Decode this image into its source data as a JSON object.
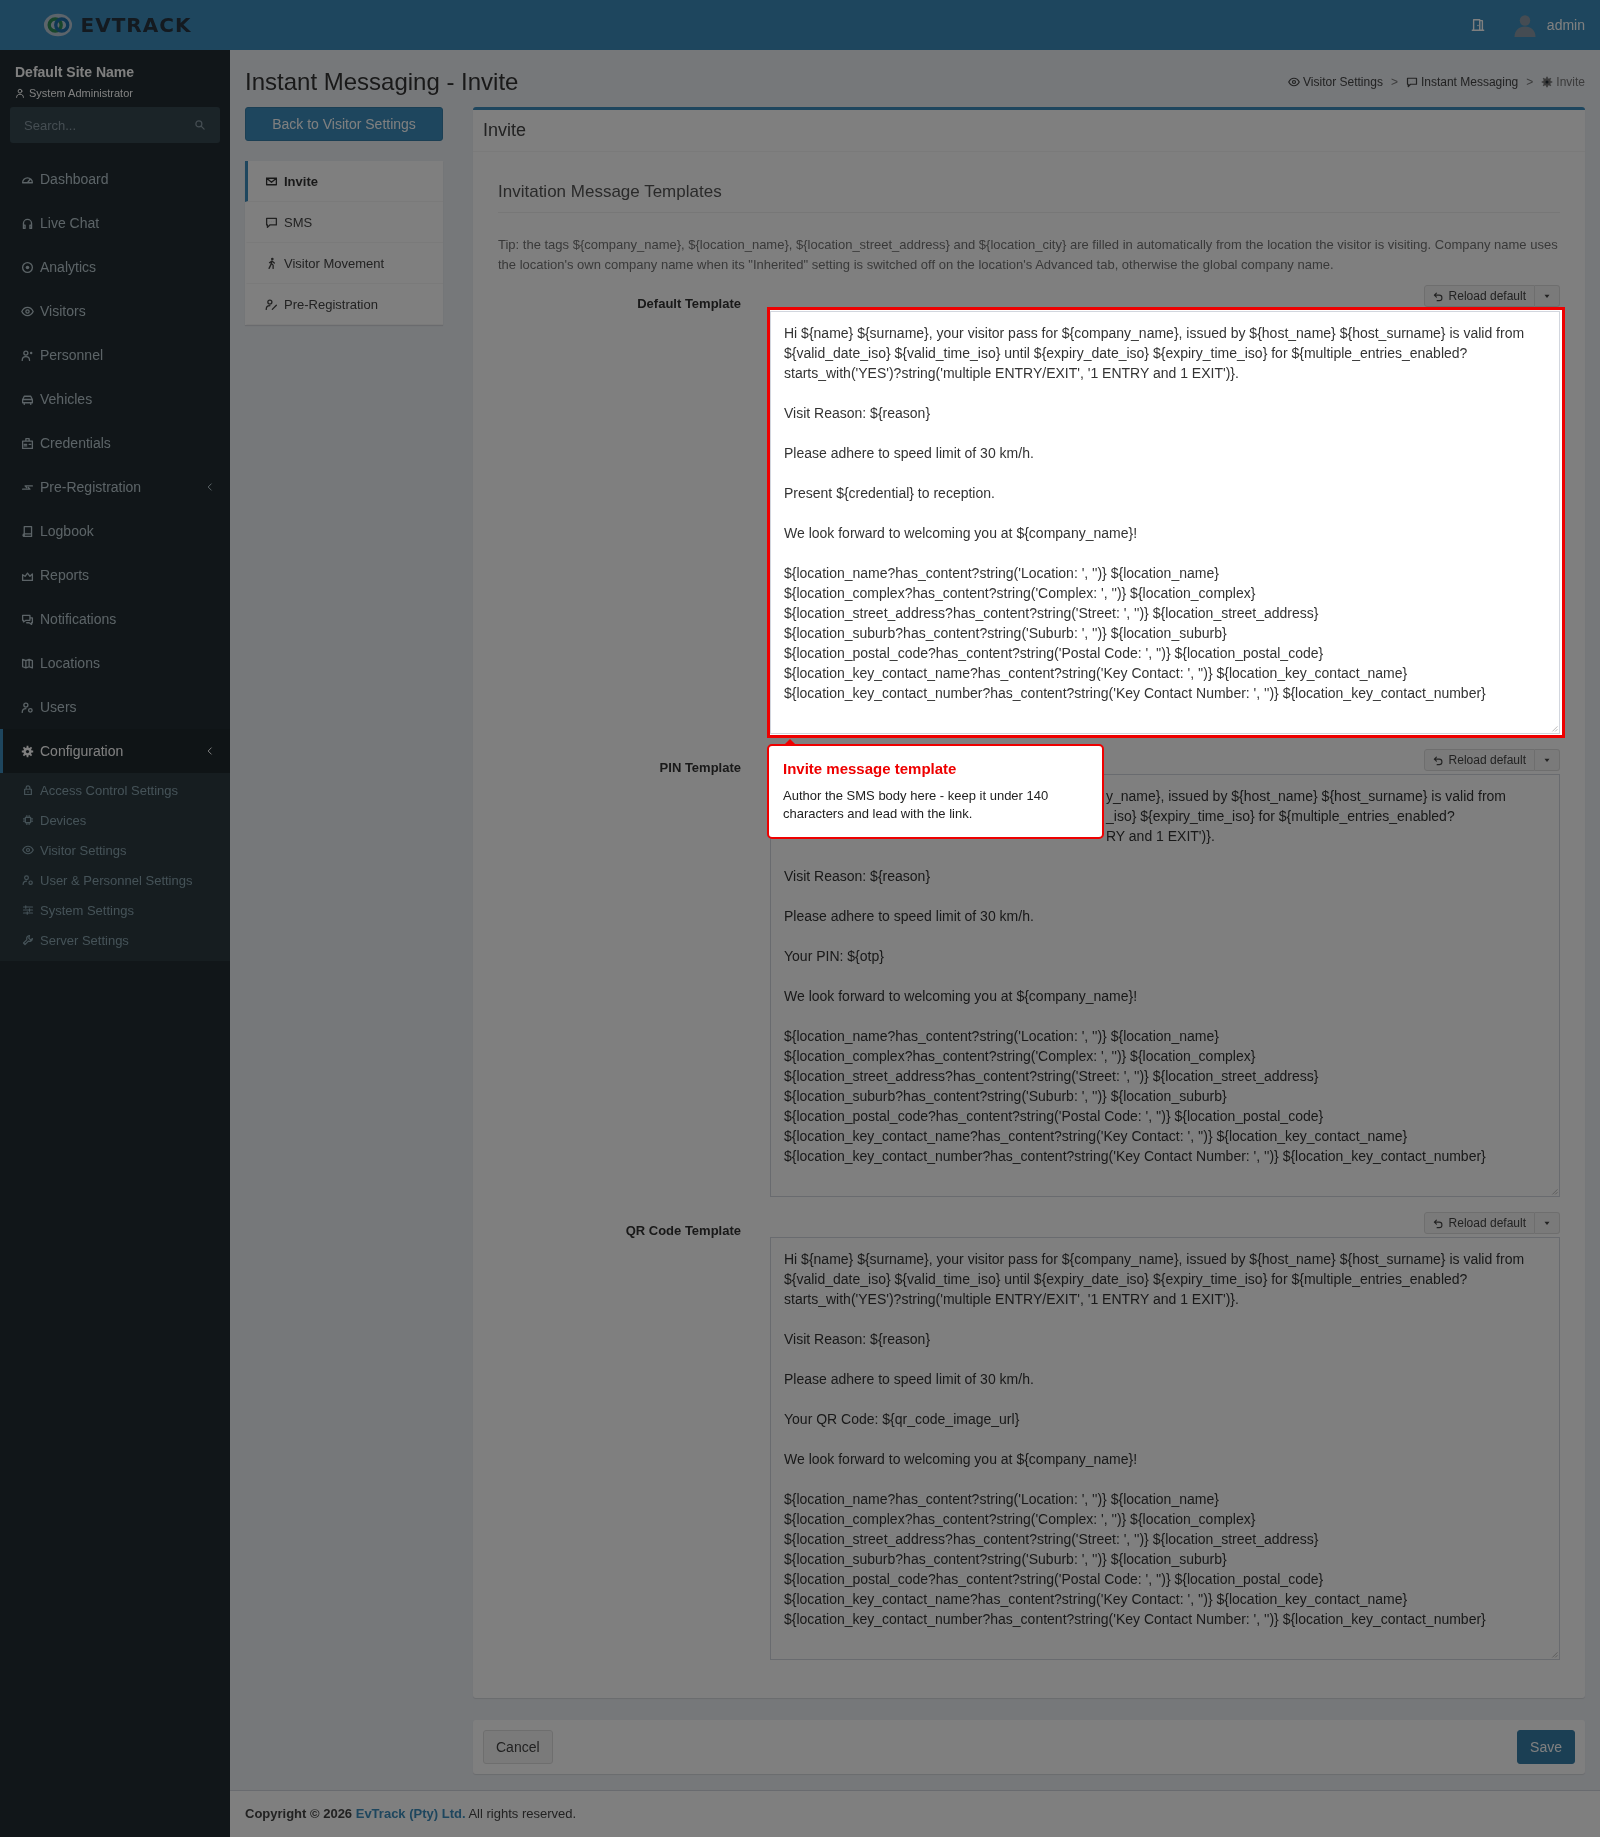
{
  "topbar": {
    "logo_text": "EVTRACK",
    "user": "admin"
  },
  "sidebar": {
    "site_name": "Default Site Name",
    "role": "System Administrator",
    "search": {
      "placeholder": "Search..."
    },
    "items": [
      {
        "label": "Dashboard",
        "selected": false
      },
      {
        "label": "Live Chat",
        "selected": false
      },
      {
        "label": "Analytics",
        "selected": false
      },
      {
        "label": "Visitors",
        "selected": false
      },
      {
        "label": "Personnel",
        "selected": false
      },
      {
        "label": "Vehicles",
        "selected": false
      },
      {
        "label": "Credentials",
        "selected": false
      },
      {
        "label": "Pre-Registration",
        "selected": false,
        "expandable": true
      },
      {
        "label": "Logbook",
        "selected": false
      },
      {
        "label": "Reports",
        "selected": false
      },
      {
        "label": "Notifications",
        "selected": false
      },
      {
        "label": "Locations",
        "selected": false
      },
      {
        "label": "Users",
        "selected": false
      },
      {
        "label": "Configuration",
        "selected": true,
        "expandable": true,
        "expanded": true,
        "children": [
          {
            "label": "Access Control Settings",
            "selected": false
          },
          {
            "label": "Devices",
            "selected": false
          },
          {
            "label": "Visitor Settings",
            "selected": false
          },
          {
            "label": "User & Personnel Settings",
            "selected": false
          },
          {
            "label": "System Settings",
            "selected": false
          },
          {
            "label": "Server Settings",
            "selected": false
          }
        ]
      }
    ]
  },
  "page": {
    "title": "Instant Messaging - Invite",
    "breadcrumb": [
      {
        "kind": "link",
        "label": "Visitor Settings"
      },
      {
        "kind": "separator",
        "label": ">"
      },
      {
        "kind": "link",
        "label": "Instant Messaging"
      },
      {
        "kind": "separator",
        "label": ">"
      },
      {
        "kind": "current",
        "label": "Invite"
      }
    ]
  },
  "back_button": "Back to Visitor Settings",
  "tabs": [
    {
      "label": "Invite",
      "selected": true
    },
    {
      "label": "SMS",
      "selected": false
    },
    {
      "label": "Visitor Movement",
      "selected": false
    },
    {
      "label": "Pre-Registration",
      "selected": false
    }
  ],
  "panel": {
    "title": "Invite",
    "section_title": "Invitation Message Templates",
    "tip": "Tip: the tags ${company_name}, ${location_name}, ${location_street_address} and ${location_city} are filled in automatically from the location the visitor is visiting. Company name uses the location's own company name when its \"Inherited\" setting is switched off on the location's Advanced tab, otherwise the global company name.",
    "templates": [
      {
        "label": "Default Template",
        "reload_label": "Reload default",
        "highlighted": true,
        "value": "Hi ${name} ${surname}, your visitor pass for ${company_name}, issued by ${host_name} ${host_surname} is valid from\n${valid_date_iso} ${valid_time_iso} until ${expiry_date_iso} ${expiry_time_iso} for ${multiple_entries_enabled?\nstarts_with('YES')?string('multiple ENTRY/EXIT', '1 ENTRY and 1 EXIT')}.\n\nVisit Reason: ${reason}\n\nPlease adhere to speed limit of 30 km/h.\n\nPresent ${credential} to reception.\n\nWe look forward to welcoming you at ${company_name}!\n\n${location_name?has_content?string('Location: ', '')} ${location_name}\n${location_complex?has_content?string('Complex: ', '')} ${location_complex}\n${location_street_address?has_content?string('Street: ', '')} ${location_street_address}\n${location_suburb?has_content?string('Suburb: ', '')} ${location_suburb}\n${location_postal_code?has_content?string('Postal Code: ', '')} ${location_postal_code}\n${location_key_contact_name?has_content?string('Key Contact: ', '')} ${location_key_contact_name}\n${location_key_contact_number?has_content?string('Key Contact Number: ', '')} ${location_key_contact_number}"
      },
      {
        "label": "PIN Template",
        "reload_label": "Reload default",
        "highlighted": false,
        "covered_lines": [
          "y_name}, issued by ${host_name} ${host_surname} is valid from",
          "_iso} ${expiry_time_iso} for ${multiple_entries_enabled?",
          "RY and 1 EXIT')}."
        ],
        "value": "\nVisit Reason: ${reason}\n\nPlease adhere to speed limit of 30 km/h.\n\nYour PIN: ${otp}\n\nWe look forward to welcoming you at ${company_name}!\n\n${location_name?has_content?string('Location: ', '')} ${location_name}\n${location_complex?has_content?string('Complex: ', '')} ${location_complex}\n${location_street_address?has_content?string('Street: ', '')} ${location_street_address}\n${location_suburb?has_content?string('Suburb: ', '')} ${location_suburb}\n${location_postal_code?has_content?string('Postal Code: ', '')} ${location_postal_code}\n${location_key_contact_name?has_content?string('Key Contact: ', '')} ${location_key_contact_name}\n${location_key_contact_number?has_content?string('Key Contact Number: ', '')} ${location_key_contact_number}"
      },
      {
        "label": "QR Code Template",
        "reload_label": "Reload default",
        "highlighted": false,
        "value": "Hi ${name} ${surname}, your visitor pass for ${company_name}, issued by ${host_name} ${host_surname} is valid from\n${valid_date_iso} ${valid_time_iso} until ${expiry_date_iso} ${expiry_time_iso} for ${multiple_entries_enabled?\nstarts_with('YES')?string('multiple ENTRY/EXIT', '1 ENTRY and 1 EXIT')}.\n\nVisit Reason: ${reason}\n\nPlease adhere to speed limit of 30 km/h.\n\nYour QR Code: ${qr_code_image_url}\n\nWe look forward to welcoming you at ${company_name}!\n\n${location_name?has_content?string('Location: ', '')} ${location_name}\n${location_complex?has_content?string('Complex: ', '')} ${location_complex}\n${location_street_address?has_content?string('Street: ', '')} ${location_street_address}\n${location_suburb?has_content?string('Suburb: ', '')} ${location_suburb}\n${location_postal_code?has_content?string('Postal Code: ', '')} ${location_postal_code}\n${location_key_contact_name?has_content?string('Key Contact: ', '')} ${location_key_contact_name}\n${location_key_contact_number?has_content?string('Key Contact Number: ', '')} ${location_key_contact_number}"
      }
    ]
  },
  "tour_tooltip": {
    "title": "Invite message template",
    "text": "Author the SMS body here - keep it under 140 characters and lead with the link."
  },
  "actions": {
    "cancel": "Cancel",
    "save": "Save"
  },
  "footer": {
    "prefix": "Copyright © 2026",
    "link": "EvTrack (Pty) Ltd.",
    "suffix": "All rights reserved."
  }
}
